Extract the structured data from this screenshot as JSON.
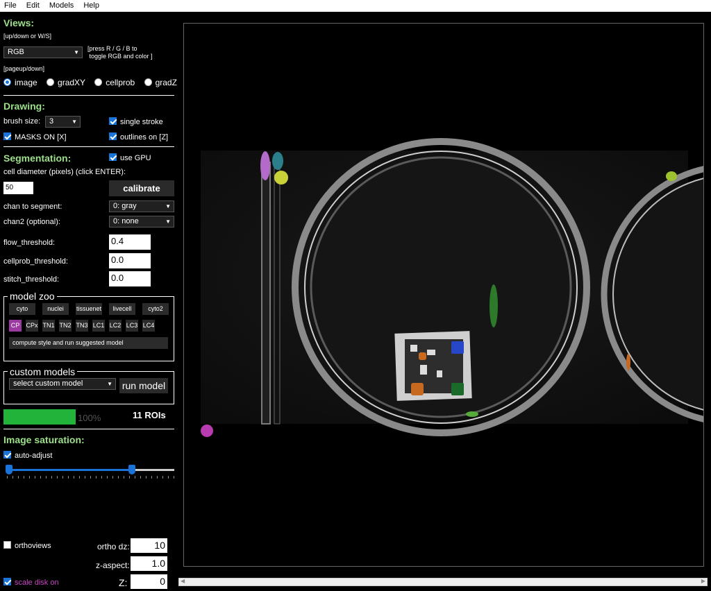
{
  "menu": [
    "File",
    "Edit",
    "Models",
    "Help"
  ],
  "views": {
    "title": "Views:",
    "hint_updown": "[up/down or W/S]",
    "select_value": "RGB",
    "hint_rgb": "[press R / G / B to\n toggle RGB and color ]",
    "hint_pageupdown": "[pageup/down]",
    "radios": [
      {
        "label": "image",
        "checked": true
      },
      {
        "label": "gradXY",
        "checked": false
      },
      {
        "label": "cellprob",
        "checked": false
      },
      {
        "label": "gradZ",
        "checked": false
      }
    ]
  },
  "drawing": {
    "title": "Drawing:",
    "brush_label": "brush size:",
    "brush_value": "3",
    "single_stroke": "single stroke",
    "masks_on": "MASKS ON [X]",
    "outlines_on": "outlines on [Z]"
  },
  "segmentation": {
    "title": "Segmentation:",
    "use_gpu": "use GPU",
    "diameter_label": "cell diameter (pixels) (click ENTER):",
    "diameter_value": "50",
    "calibrate": "calibrate",
    "chan_label": "chan to segment:",
    "chan_value": "0: gray",
    "chan2_label": "chan2 (optional):",
    "chan2_value": "0: none",
    "flow_label": "flow_threshold:",
    "flow_value": "0.4",
    "cellprob_label": "cellprob_threshold:",
    "cellprob_value": "0.0",
    "stitch_label": "stitch_threshold:",
    "stitch_value": "0.0"
  },
  "model_zoo": {
    "title": "model zoo",
    "row1": [
      "cyto",
      "nuclei",
      "tissuenet",
      "livecell",
      "cyto2"
    ],
    "row2": [
      "CP",
      "CPx",
      "TN1",
      "TN2",
      "TN3",
      "LC1",
      "LC2",
      "LC3",
      "LC4"
    ],
    "selected": "CP",
    "compute_style": "compute style and run suggested model"
  },
  "custom_models": {
    "title": "custom models",
    "select_value": "select custom model",
    "run_model": "run model"
  },
  "progress": {
    "value": 1.0,
    "text": "100%"
  },
  "rois": "11 ROIs",
  "saturation": {
    "title": "Image saturation:",
    "auto_adjust": "auto-adjust",
    "low": 0.0,
    "high": 0.73
  },
  "bottom": {
    "orthoviews": "orthoviews",
    "ortho_dz_label": "ortho dz:",
    "ortho_dz_value": "10",
    "z_aspect_label": "z-aspect:",
    "z_aspect_value": "1.0",
    "scale_disk": "scale disk on",
    "z_label": "Z:",
    "z_value": "0"
  },
  "colors": {
    "accent_green": "#9de08a",
    "progress_green": "#22b33a",
    "selected_purple": "#9b3aa0",
    "scale_disk_magenta": "#c847c4",
    "toggle_blue": "#1a73d9"
  }
}
